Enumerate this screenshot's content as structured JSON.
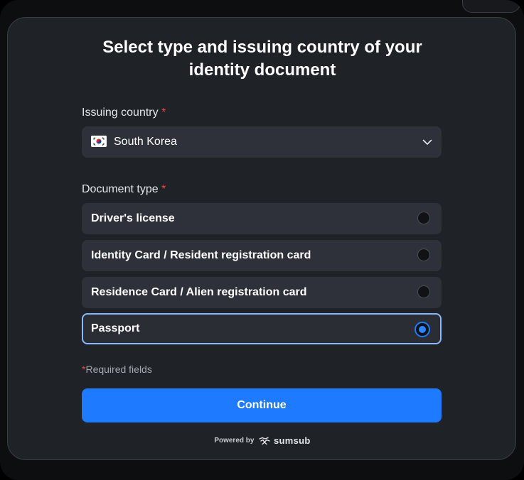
{
  "title": {
    "line1": "Select type and issuing country of your",
    "line2": "identity document"
  },
  "country_field": {
    "label": "Issuing country",
    "required_mark": "*",
    "selected_value": "South Korea",
    "flag_icon": "south-korea-flag-icon"
  },
  "document_type": {
    "label": "Document type",
    "required_mark": "*",
    "options": [
      {
        "label": "Driver's license",
        "selected": false
      },
      {
        "label": "Identity Card / Resident registration card",
        "selected": false
      },
      {
        "label": "Residence Card / Alien registration card",
        "selected": false
      },
      {
        "label": "Passport",
        "selected": true
      }
    ]
  },
  "required_note": {
    "mark": "*",
    "text": "Required fields"
  },
  "continue_button": {
    "label": "Continue"
  },
  "footer": {
    "powered_by": "Powered by",
    "brand": "sumsub",
    "brand_icon": "sumsub-logo-icon"
  },
  "colors": {
    "accent": "#1e7bff",
    "card_bg": "#1f2227",
    "field_bg": "#2e3139",
    "required": "#ef4444",
    "selected_border": "#8bb7ff"
  }
}
